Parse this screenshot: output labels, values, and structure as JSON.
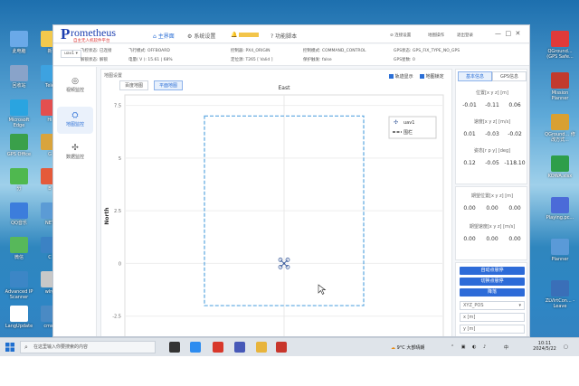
{
  "desktop": {
    "left_icons": [
      {
        "label": "此电脑"
      },
      {
        "label": "新"
      },
      {
        "label": "回收站"
      },
      {
        "label": "Tele"
      },
      {
        "label": "Microsoft Edge"
      },
      {
        "label": "Hi"
      },
      {
        "label": "GPS Office"
      },
      {
        "label": "G"
      },
      {
        "label": "分"
      },
      {
        "label": "B"
      },
      {
        "label": "QQ音乐"
      },
      {
        "label": "NET"
      },
      {
        "label": "微信"
      },
      {
        "label": "C"
      },
      {
        "label": "Advanced IP Scanner"
      },
      {
        "label": "wlrg"
      },
      {
        "label": "LangUpdate"
      },
      {
        "label": "cmso"
      }
    ],
    "right_icons": [
      {
        "label": "QGround... (GPS Safe..."
      },
      {
        "label": "Mission Planner"
      },
      {
        "label": "QGround... 修改方式..."
      },
      {
        "label": "KOWA.xlsx"
      },
      {
        "label": "Playing.pc..."
      },
      {
        "label": "Planner"
      },
      {
        "label": "ZLVirtCon... - Leave"
      }
    ]
  },
  "topbar": {
    "brand_initial": "P",
    "brand_rest": "rometheus",
    "brand_sub": "自主无人机软件平台",
    "nav": [
      {
        "icon": "home-icon",
        "label": "主界面",
        "active": true
      },
      {
        "icon": "settings-icon",
        "label": "系统设置",
        "active": false
      },
      {
        "icon": "bell-icon",
        "label": "",
        "active": false
      },
      {
        "icon": "help-icon",
        "label": "功能脚本",
        "active": false
      }
    ],
    "right": [
      "连接设置",
      "地图操作",
      "退出登录"
    ]
  },
  "status": {
    "row1": [
      {
        "label": "飞控状态:",
        "value": "已连接"
      },
      {
        "label": "飞行模式:",
        "value": "OFFBOARD"
      },
      {
        "label": "控制器:",
        "value": "PX4_ORIGIN"
      },
      {
        "label": "控制模式:",
        "value": "COMMAND_CONTROL"
      },
      {
        "label": "GPS状态:",
        "value": "GPS_FIX_TYPE_NO_GPS"
      }
    ],
    "row2": [
      {
        "label": "解锁状态:",
        "value": "解锁"
      },
      {
        "label": "电量( V ):",
        "value": "15.61 | 68%"
      },
      {
        "label": "定位源:",
        "value": "T265 [ Valid ]"
      },
      {
        "label": "保护触发:",
        "value": "false"
      },
      {
        "label": "GPS星数:",
        "value": "0"
      }
    ],
    "uav_select": "uav1"
  },
  "sidebar": [
    {
      "icon": "monitor-icon",
      "label": "视频监控",
      "active": false
    },
    {
      "icon": "map-icon",
      "label": "地图监控",
      "active": true
    },
    {
      "icon": "data-icon",
      "label": "数据监控",
      "active": false
    }
  ],
  "plot_panel": {
    "section_label": "地图设置",
    "tabs": [
      "百度地图",
      "平面地图"
    ],
    "active_tab": "平面地图",
    "checkboxes": [
      "轨迹显示",
      "地图锁定"
    ]
  },
  "chart_data": {
    "type": "scatter",
    "title": "East",
    "xlabel": "",
    "ylabel": "North",
    "ylim": [
      -3.5,
      8
    ],
    "xlim": [
      -8,
      8
    ],
    "yticks": [
      -2.5,
      0,
      2.5,
      5,
      7.5
    ],
    "ytick_labels": [
      "-2.5",
      "0",
      "2.5",
      "5",
      "7.5"
    ],
    "series": [
      {
        "name": "uav1",
        "points": [
          [
            0,
            0
          ]
        ]
      }
    ],
    "geofence": {
      "name": "围栏",
      "x": [
        -4,
        4
      ],
      "y": [
        -2,
        7
      ]
    },
    "legend_placement": "top-right",
    "grid": true,
    "colors": {
      "fence": "#5aa6e0",
      "uav": "#3e5f9e"
    }
  },
  "right_panel": {
    "tabs": [
      "基本信息",
      "GPS信息"
    ],
    "active_tab": "基本信息",
    "position": {
      "title": "位置[x y z] [m]",
      "values": [
        "-0.01",
        "-0.11",
        "0.06"
      ]
    },
    "velocity": {
      "title": "速度[x y z] [m/s]",
      "values": [
        "0.01",
        "-0.03",
        "-0.02"
      ]
    },
    "attitude": {
      "title": "姿态[r p y] [deg]",
      "values": [
        "0.12",
        "-0.05",
        "-118.10"
      ]
    },
    "target_pos": {
      "title": "期望位置[x y z] [m]",
      "values": [
        "0.00",
        "0.00",
        "0.00"
      ]
    },
    "target_vel": {
      "title": "期望速度[x y z] [m/s]",
      "values": [
        "0.00",
        "0.00",
        "0.00"
      ]
    },
    "buttons": [
      "自动点悬停",
      "切换点悬停",
      "降落"
    ],
    "mode_select": "XYZ_POS",
    "inputs": [
      "x [m]",
      "y [m]"
    ]
  },
  "taskbar": {
    "search_placeholder": "在这里输入你要搜索的内容",
    "weather": "9°C 大部晴朗",
    "ime": "中",
    "time": "10:11",
    "date": "2024/5/22"
  }
}
